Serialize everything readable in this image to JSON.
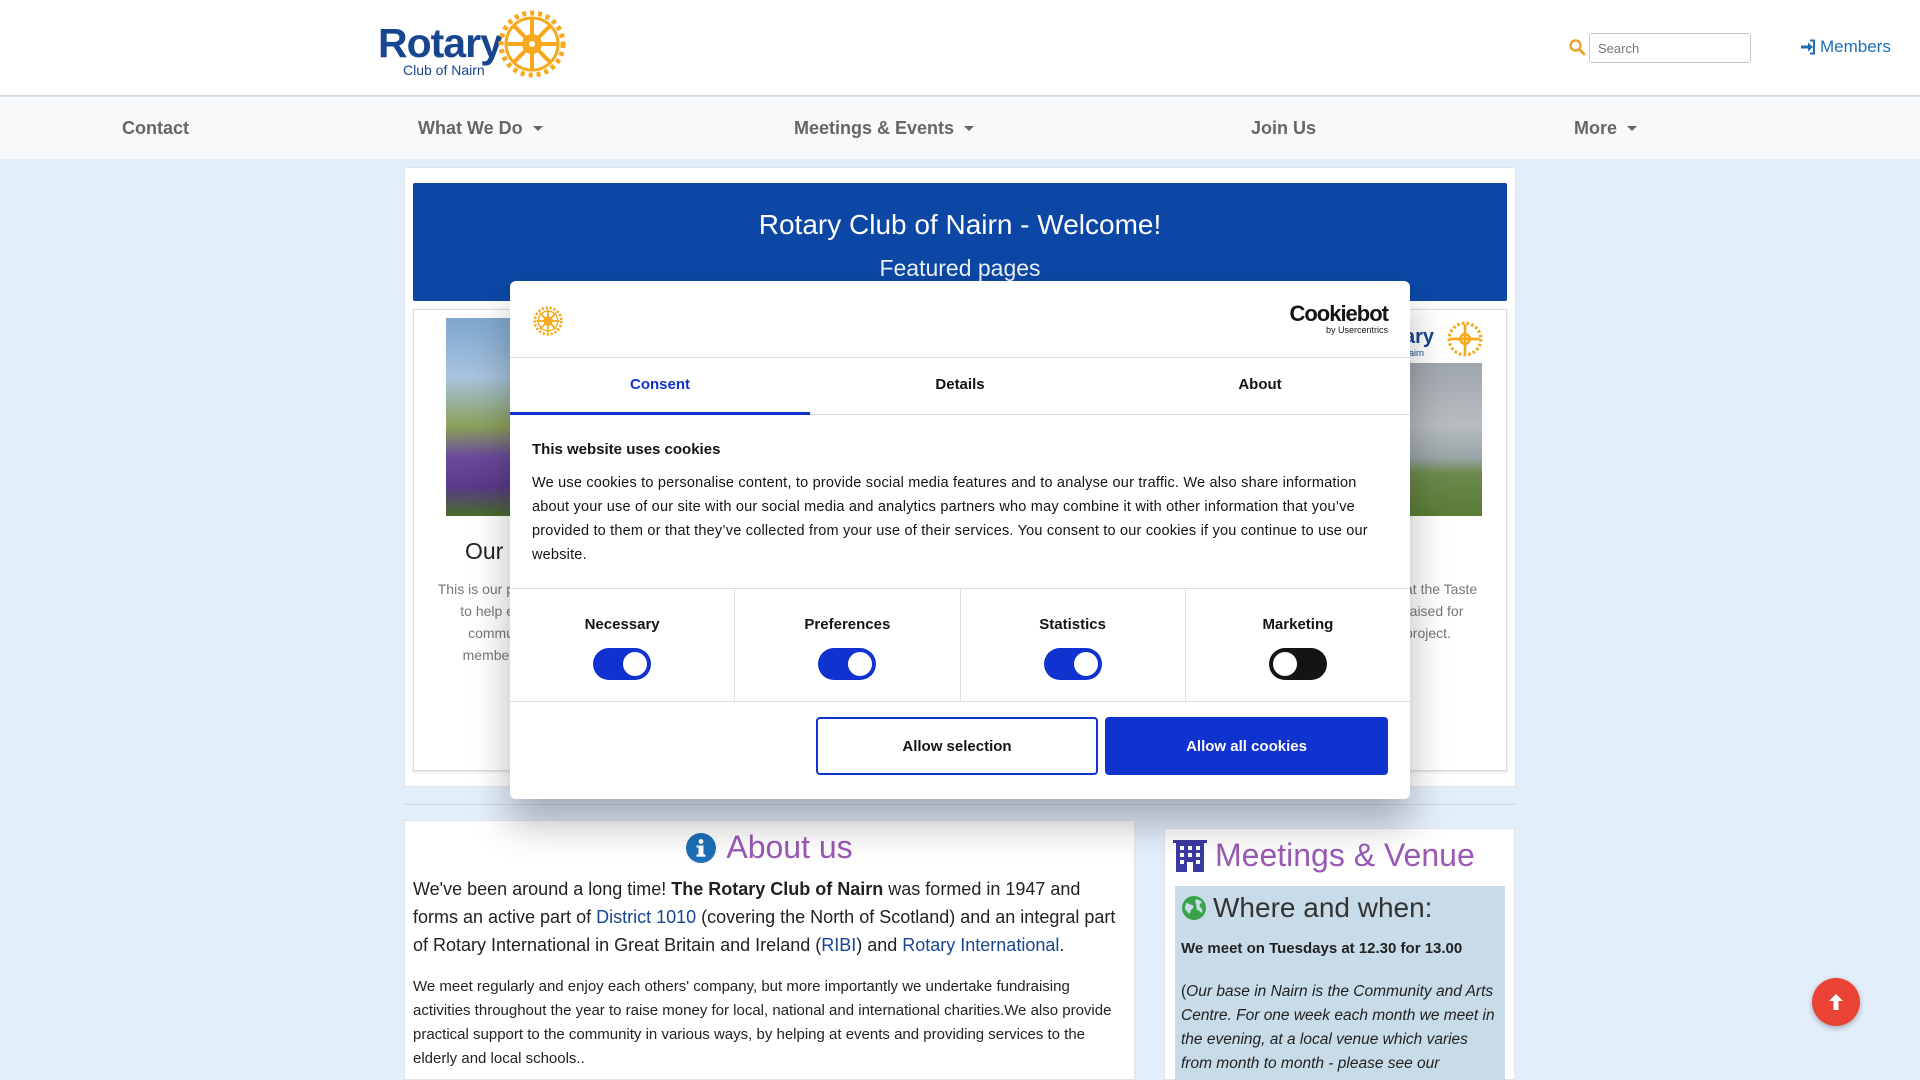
{
  "header": {
    "logo_word": "Rotary",
    "logo_sub": "Club of Nairn",
    "search_placeholder": "Search",
    "members_label": "Members",
    "accent": "#17458f",
    "wheel_color": "#f7a81b"
  },
  "nav": {
    "items": [
      {
        "label": "Contact",
        "dropdown": false
      },
      {
        "label": "What We Do",
        "dropdown": true
      },
      {
        "label": "Meetings & Events",
        "dropdown": true
      },
      {
        "label": "Join Us",
        "dropdown": false
      },
      {
        "label": "More",
        "dropdown": true
      }
    ]
  },
  "banner": {
    "title": "Rotary Club of Nairn - Welcome!",
    "subtitle": "Featured pages",
    "color": "#0c47a5"
  },
  "cards": {
    "left_title": "Our",
    "left_text": "This is our p to help e commu member",
    "right_logo_text": "ary",
    "right_logo_sub": "airn",
    "right_text": "at the Taste raised for project."
  },
  "about": {
    "title": "About us",
    "lead_1": "We've been around a long time! ",
    "lead_bold": "The Rotary Club of Nairn",
    "lead_2": " was formed in 1947 and forms an active part of ",
    "link_district": "District 1010",
    "lead_3": " (covering the North of Scotland) and an integral part of Rotary International in Great Britain and Ireland (",
    "link_ribi": "RIBI",
    "lead_4": ") and ",
    "link_ri": "Rotary International",
    "lead_5": ".",
    "body": "We meet regularly and enjoy each others' company, but more importantly we undertake fundraising activities throughout the year to raise money for local, national and international charities.We also provide practical support to the community in various ways, by helping at events and providing services to the elderly and local schools.."
  },
  "meetings": {
    "title": "Meetings & Venue",
    "subtitle": "Where and when:",
    "when": "We meet on Tuesdays at 12.30 for 13.00",
    "base_open": "(",
    "base": "Our base in Nairn is the Community and Arts Centre. For one week each month we meet in the evening, at a local venue which varies from month to month - please see our calendar of events or list of future meetings"
  },
  "cookie": {
    "brand": "Cookiebot",
    "brand_sub": "by Usercentrics",
    "tabs": [
      "Consent",
      "Details",
      "About"
    ],
    "active_tab": "Consent",
    "heading": "This website uses cookies",
    "body": "We use cookies to personalise content, to provide social media features and to analyse our traffic. We also share information about your use of our site with our social media and analytics partners who may combine it with other information that you’ve provided to them or that they’ve collected from your use of their services. You consent to our cookies if you continue to use our website.",
    "toggles": [
      {
        "label": "Necessary",
        "on": true
      },
      {
        "label": "Preferences",
        "on": true
      },
      {
        "label": "Statistics",
        "on": true
      },
      {
        "label": "Marketing",
        "on": false
      }
    ],
    "btn_selection": "Allow selection",
    "btn_all": "Allow all cookies",
    "accent": "#1032cf"
  }
}
